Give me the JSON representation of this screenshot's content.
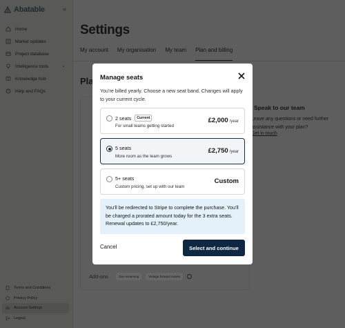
{
  "app": {
    "name": "Abatable"
  },
  "sidebar": {
    "items": [
      {
        "label": "Home",
        "icon": "home-icon"
      },
      {
        "label": "Market updates",
        "icon": "market-updates-icon"
      },
      {
        "label": "Project database",
        "icon": "database-icon"
      },
      {
        "label": "Intelligence tools",
        "icon": "lightbulb-icon",
        "expandable": true
      },
      {
        "label": "Knowledge hub",
        "icon": "book-icon"
      },
      {
        "label": "Help and FAQs",
        "icon": "help-icon"
      }
    ],
    "bottom_items": [
      {
        "label": "Terms and Conditions",
        "icon": "document-icon"
      },
      {
        "label": "Privacy Policy",
        "icon": "shield-icon"
      },
      {
        "label": "Account Settings",
        "icon": "gear-icon",
        "active": true
      },
      {
        "label": "Logout",
        "icon": "logout-icon"
      }
    ]
  },
  "main": {
    "title": "Settings",
    "tabs": [
      {
        "label": "My account"
      },
      {
        "label": "My organisation"
      },
      {
        "label": "My team"
      },
      {
        "label": "Plan and billing",
        "active": true
      }
    ],
    "plan_heading_partial": "Plan",
    "speak_title": "Speak to our team",
    "speak_text": "Leave any questions or need further assistance with your plan?",
    "speak_link": "Get in touch",
    "addons_label": "Add-ons",
    "addon_pills": [
      "Geo screening",
      "Vintage forward curves"
    ]
  },
  "modal": {
    "title": "Manage seats",
    "intro": "You're billed yearly. Choose a new seat band. Changes will apply to your current cycle.",
    "options": [
      {
        "name": "2 seats",
        "badge": "Current",
        "desc": "For small teams getting started",
        "price": "£2,000",
        "per": "/year",
        "selected": false
      },
      {
        "name": "5 seats",
        "badge": "",
        "desc": "More room as the team grows",
        "price": "£2,750",
        "per": "/year",
        "selected": true
      },
      {
        "name": "5+ seats",
        "badge": "",
        "desc": "Custom pricing, set up with our team",
        "price": "Custom",
        "per": "",
        "selected": false
      }
    ],
    "info": "You'll be redirected to Stripe to complete the purchase. You'll be charged a prorated amount today for the 3 extra seats. Renewal updates to £2,750/year.",
    "cancel_label": "Cancel",
    "submit_label": "Select and continue"
  },
  "colors": {
    "overlay": "#5e5e5e",
    "primary": "#0e2742",
    "info_bg": "#e4f1fb",
    "brand": "#1b2a2c"
  }
}
